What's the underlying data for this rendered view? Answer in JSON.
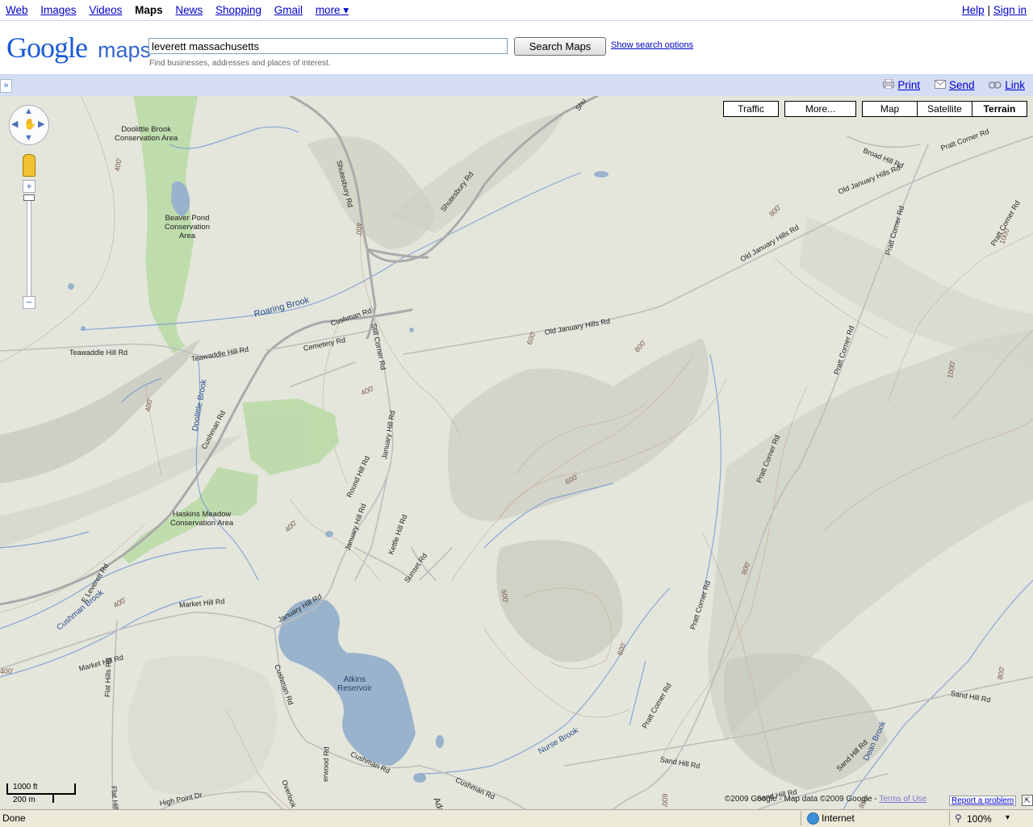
{
  "topnav": {
    "links": [
      "Web",
      "Images",
      "Videos",
      "Maps",
      "News",
      "Shopping",
      "Gmail",
      "more ▾"
    ],
    "current": "Maps",
    "help": "Help",
    "sep": "|",
    "signin": "Sign in"
  },
  "header": {
    "logo_google": "Google",
    "logo_maps": "maps",
    "search_value": "leverett massachusetts",
    "search_button": "Search Maps",
    "search_options": "Show search options",
    "hint": "Find businesses, addresses and places of interest."
  },
  "toolbar": {
    "collapse": "»",
    "print": "Print",
    "send": "Send",
    "link": "Link"
  },
  "map_type": {
    "traffic": "Traffic",
    "more": "More...",
    "map": "Map",
    "satellite": "Satellite",
    "terrain": "Terrain",
    "selected": "Terrain"
  },
  "zoom": {
    "plus": "+",
    "minus": "−"
  },
  "scale": {
    "imperial": "1000 ft",
    "metric": "200 m"
  },
  "map_labels": {
    "areas": [
      "Doolittle Brook\nConservation Area",
      "Beaver Pond\nConservation\nArea",
      "Haskins Meadow\nConservation Area"
    ],
    "water": [
      "Roaring Brook",
      "Doolittle Brook",
      "Cushman Brook",
      "Atkins\nReservoir",
      "Nurse Brook",
      "Dean Brook"
    ],
    "roads": [
      "Shutesbury Rd",
      "Shutesbury Rd",
      "Shu",
      "Cushman Rd",
      "Cushman Rd",
      "Cushman Rd",
      "Cushman Rd",
      "Cushman Rd",
      "Teawaddle Hill Rd",
      "Teawaddle Hill Rd",
      "Cemetery Rd",
      "Still Corner Rd",
      "Old January Hills Rd",
      "Old January Hills Rd",
      "Old January Hills Rd",
      "Broad Hill Rd",
      "Pratt Corner Rd",
      "Pratt Corner Rd",
      "Pratt Corner Rd",
      "Pratt Corner Rd",
      "Pratt Corner Rd",
      "Pratt Corner Rd",
      "Pratt Corner Rd",
      "January Hill Rd",
      "January Hill Rd",
      "January Hill Rd",
      "Round Hill Rd",
      "Kettle Hill Rd",
      "Sunset Rd",
      "E Leverett Rd",
      "Market Hill Rd",
      "Market Hill Rd",
      "Flat Hills Rd",
      "Flat Hill",
      "High Point Dr",
      "Overlook D",
      "erwood Rd",
      "Ada",
      "Sand Hill Rd",
      "Sand Hill Rd",
      "Sand Hill Rd",
      "Sand Hill Rd"
    ],
    "elevations": [
      "400'",
      "400'",
      "400'",
      "400'",
      "400'",
      "400'",
      "400'",
      "600'",
      "600'",
      "600'",
      "600'",
      "600'",
      "800'",
      "800'",
      "800'",
      "800'",
      "800'",
      "1000'",
      "1000'"
    ]
  },
  "copyright": {
    "text": "©2009 Google - Map data ©2009 Google -",
    "terms": "Terms of Use",
    "report": "Report a problem"
  },
  "status": {
    "left": "Done",
    "zone": "Internet",
    "zoom": "100%",
    "zoom_arrow": "▾"
  },
  "colors": {
    "terrain_bg": "#e4e6dc",
    "park": "#b4d8a0",
    "water": "#99b3cc",
    "road": "#a8a8a8",
    "toolbar": "#d5ddf3",
    "logo_blue": "#3366cc"
  }
}
